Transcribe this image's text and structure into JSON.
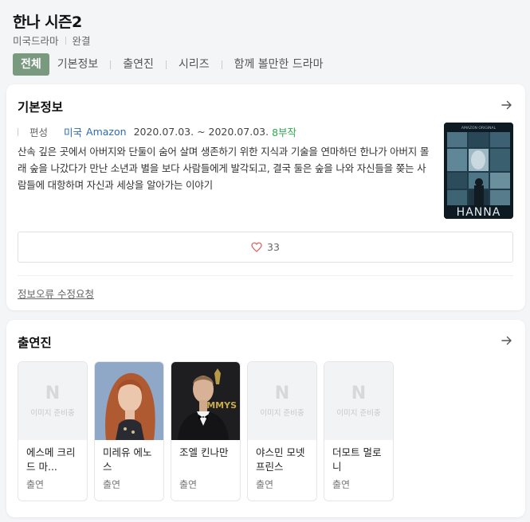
{
  "header": {
    "title": "한나 시즌2",
    "genre": "미국드라마",
    "status": "완결"
  },
  "tabs": [
    {
      "label": "전체",
      "active": true
    },
    {
      "label": "기본정보",
      "active": false
    },
    {
      "label": "출연진",
      "active": false
    },
    {
      "label": "시리즈",
      "active": false
    },
    {
      "label": "함께 볼만한 드라마",
      "active": false
    }
  ],
  "basic_info": {
    "title": "기본정보",
    "meta_label": "편성",
    "country": "미국",
    "network": "Amazon",
    "dates": "2020.07.03. ~ 2020.07.03.",
    "episodes": "8부작",
    "synopsis": "산속 깊은 곳에서 아버지와 단둘이 숨어 살며 생존하기 위한 지식과 기술을 연마하던 한나가 아버지 몰래 숲을 나갔다가 만난 소년과 별을 보다 사람들에게 발각되고, 결국 둘은 숲을 나와 자신들을 쫒는 사람들에 대항하며 자신과 세상을 알아가는 이야기",
    "poster": {
      "top_text": "AMAZON ORIGINAL",
      "title_text": "HANNA"
    },
    "likes": "33",
    "report_link": "정보오류 수정요청"
  },
  "cast_section": {
    "title": "출연진",
    "members": [
      {
        "name": "에스메 크리드 마...",
        "role": "출연",
        "has_photo": false,
        "placeholder_letter": "N",
        "placeholder_text": "이미지 준비중"
      },
      {
        "name": "미레유 에노스",
        "role": "출연",
        "has_photo": true,
        "photo": "woman-red-hair"
      },
      {
        "name": "조엘 킨나만",
        "role": "출연",
        "has_photo": true,
        "photo": "man-tuxedo",
        "photo_text": "MMYS"
      },
      {
        "name": "야스민 모넷 프린스",
        "role": "출연",
        "has_photo": false,
        "placeholder_letter": "N",
        "placeholder_text": "이미지 준비중"
      },
      {
        "name": "더모트 멀로니",
        "role": "출연",
        "has_photo": false,
        "placeholder_letter": "N",
        "placeholder_text": "이미지 준비중"
      }
    ]
  },
  "colors": {
    "accent_tab": "#7a9a80",
    "link": "#2a6ab8",
    "episodes": "#2fa84f",
    "heart": "#e05a5a"
  }
}
